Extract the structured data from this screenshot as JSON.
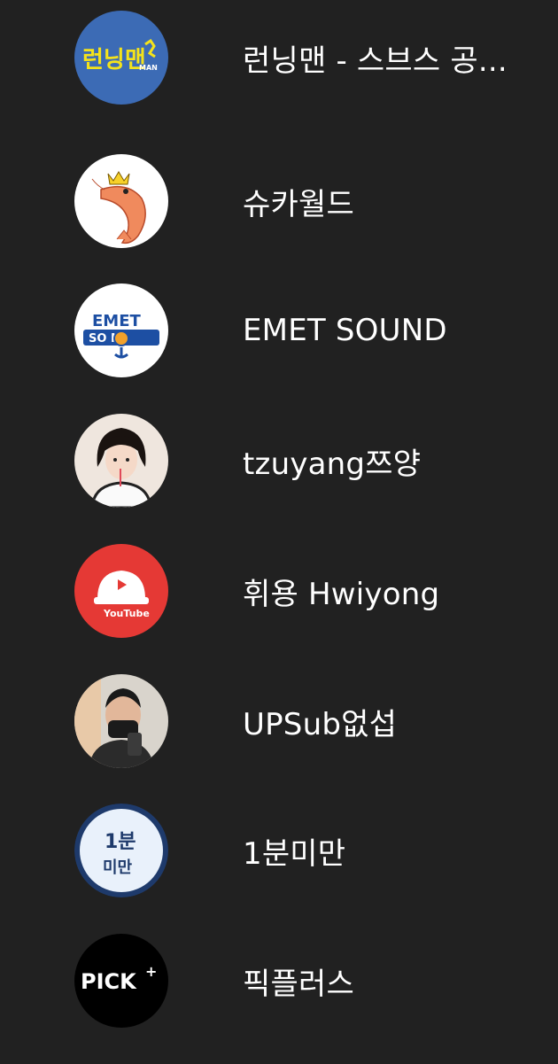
{
  "channels": [
    {
      "name": "런닝맨 - 스브스 공...",
      "avatar_icon": "runningman-logo-icon",
      "logo_text": "런닝맨",
      "logo_sub": "MAN",
      "bg": "#3c6bb5"
    },
    {
      "name": "슈카월드",
      "avatar_icon": "shrimp-logo-icon",
      "bg": "#ffffff"
    },
    {
      "name": "EMET SOUND",
      "avatar_icon": "emet-sound-logo-icon",
      "logo_text": "EMET",
      "logo_sub": "SO N",
      "bg": "#ffffff"
    },
    {
      "name": "tzuyang쯔양",
      "avatar_icon": "tzuyang-avatar-icon",
      "bg": "#efe6de"
    },
    {
      "name": "휘용 Hwiyong",
      "avatar_icon": "hwiyong-logo-icon",
      "logo_text": "YouTube",
      "bg": "#e53935"
    },
    {
      "name": "UPSub없섭",
      "avatar_icon": "upsub-avatar-icon",
      "bg": "#d9d4cc"
    },
    {
      "name": "1분미만",
      "avatar_icon": "one-minute-logo-icon",
      "logo_text": "1분",
      "logo_sub": "미만",
      "bg": "#e9f1fb"
    },
    {
      "name": "픽플러스",
      "avatar_icon": "pickplus-logo-icon",
      "logo_text": "PICK",
      "logo_sub": "+",
      "bg": "#000000"
    }
  ]
}
